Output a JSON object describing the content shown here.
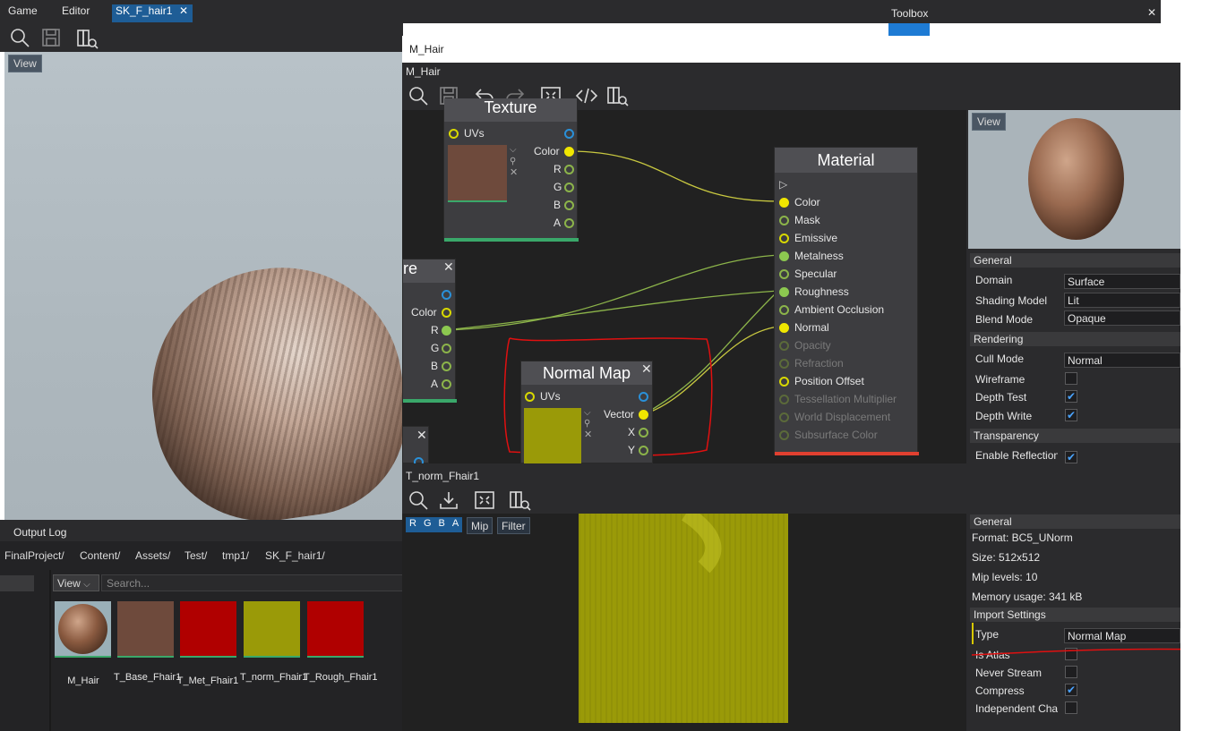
{
  "top_tabs": [
    "Game",
    "Editor",
    "SK_F_hair1"
  ],
  "toolbox": {
    "title": "Toolbox",
    "close": "✕"
  },
  "main_view": {
    "view_label": "View"
  },
  "output_log": "Output Log",
  "breadcrumb": [
    "FinalProject/",
    "Content/",
    "Assets/",
    "Test/",
    "tmp1/",
    "SK_F_hair1/"
  ],
  "content": {
    "view_label": "View",
    "search_placeholder": "Search...",
    "assets": [
      {
        "name": "M_Hair",
        "color": "#8a6a5a"
      },
      {
        "name": "T_Base_Fhair1",
        "color": "#6e4a3c"
      },
      {
        "name": "T_Met_Fhair1",
        "color": "#b00000"
      },
      {
        "name": "T_norm_Fhair1",
        "color": "#9a9a08"
      },
      {
        "name": "T_Rough_Fhair1",
        "color": "#b00000"
      }
    ]
  },
  "material_window": {
    "title": "M_Hair",
    "subtitle": "M_Hair",
    "view_label": "View",
    "nodes": {
      "texture": {
        "title": "Texture",
        "uvs": "UVs",
        "outputs": [
          "Color",
          "R",
          "G",
          "B",
          "A"
        ]
      },
      "texture2": {
        "title": "re",
        "outputs": [
          "Color",
          "R",
          "G",
          "B",
          "A"
        ]
      },
      "normal_map": {
        "title": "Normal Map",
        "uvs": "UVs",
        "outputs": [
          "Vector",
          "X",
          "Y"
        ]
      },
      "material": {
        "title": "Material",
        "inputs": [
          "Color",
          "Mask",
          "Emissive",
          "Metalness",
          "Specular",
          "Roughness",
          "Ambient Occlusion",
          "Normal",
          "Opacity",
          "Refraction",
          "Position Offset",
          "Tessellation Multiplier",
          "World Displacement",
          "Subsurface Color"
        ]
      }
    },
    "properties": {
      "general_header": "General",
      "domain_label": "Domain",
      "domain_value": "Surface",
      "shading_label": "Shading Model",
      "shading_value": "Lit",
      "blend_label": "Blend Mode",
      "blend_value": "Opaque",
      "rendering_header": "Rendering",
      "cull_label": "Cull Mode",
      "cull_value": "Normal",
      "wireframe_label": "Wireframe",
      "depth_test_label": "Depth Test",
      "depth_write_label": "Depth Write",
      "transparency_header": "Transparency",
      "enable_refl_label": "Enable Reflections"
    }
  },
  "texture_window": {
    "title": "T_norm_Fhair1",
    "channels": [
      "R",
      "G",
      "B",
      "A"
    ],
    "mip_label": "Mip",
    "filter_label": "Filter",
    "general_header": "General",
    "format": "Format: BC5_UNorm",
    "size": "Size: 512x512",
    "mips": "Mip levels: 10",
    "memory": "Memory usage: 341 kB",
    "import_header": "Import Settings",
    "type_label": "Type",
    "type_value": "Normal Map",
    "is_atlas": "Is Atlas",
    "never_stream": "Never Stream",
    "compress": "Compress",
    "independent": "Independent Channels"
  },
  "colors": {
    "accent": "#1e5d96",
    "annotation": "#e01010",
    "wire_yellow": "#c8c840",
    "wire_green": "#8cb44a"
  }
}
